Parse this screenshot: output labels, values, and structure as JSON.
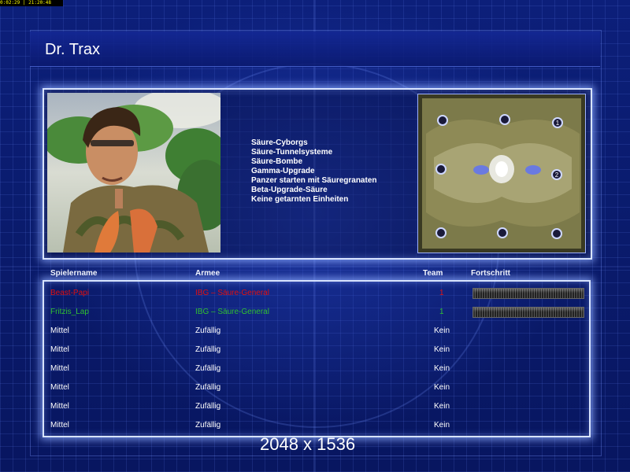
{
  "status_bar": {
    "text": "0:02:29 | 21:20:48"
  },
  "general": {
    "name": "Dr. Trax",
    "bonuses": [
      "Säure-Cyborgs",
      "Säure-Tunnelsysteme",
      "Säure-Bombe",
      "Gamma-Upgrade",
      "Panzer starten mit Säuregranaten",
      "Beta-Upgrade-Säure",
      "Keine getarnten Einheiten"
    ]
  },
  "minimap": {
    "start_markers": [
      "1",
      "2"
    ]
  },
  "table": {
    "headers": {
      "name": "Spielername",
      "army": "Armee",
      "team": "Team",
      "progress": "Fortschritt"
    },
    "rows": [
      {
        "name": "Beast-Papi",
        "army": "IBG – Säure-General",
        "team": "1",
        "color": "#e01010",
        "progress": 1.0
      },
      {
        "name": "Fritzis_Lap",
        "army": "IBG – Säure-General",
        "team": "1",
        "color": "#30c030",
        "progress": 1.0
      },
      {
        "name": "Mittel",
        "army": "Zufällig",
        "team": "Kein",
        "color": "#ffffff"
      },
      {
        "name": "Mittel",
        "army": "Zufällig",
        "team": "Kein",
        "color": "#ffffff"
      },
      {
        "name": "Mittel",
        "army": "Zufällig",
        "team": "Kein",
        "color": "#ffffff"
      },
      {
        "name": "Mittel",
        "army": "Zufällig",
        "team": "Kein",
        "color": "#ffffff"
      },
      {
        "name": "Mittel",
        "army": "Zufällig",
        "team": "Kein",
        "color": "#ffffff"
      },
      {
        "name": "Mittel",
        "army": "Zufällig",
        "team": "Kein",
        "color": "#ffffff"
      }
    ]
  },
  "overlay": {
    "resolution": "2048 x 1536"
  },
  "colors": {
    "panel_glow": "#d8e4ff",
    "background": "#0a1a6e"
  }
}
